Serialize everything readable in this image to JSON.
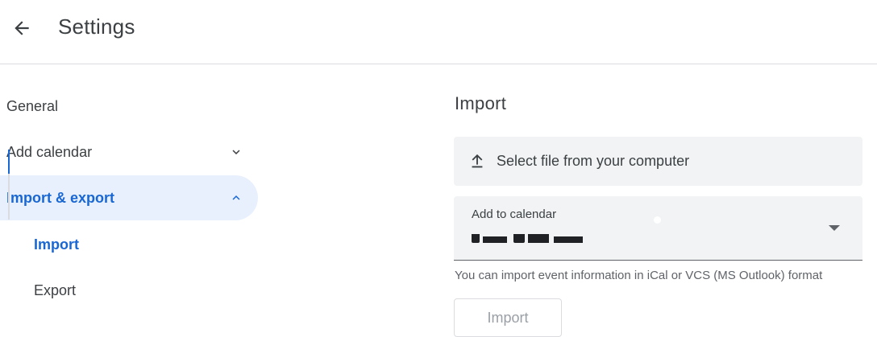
{
  "header": {
    "back_icon": "arrow-back-icon",
    "title": "Settings"
  },
  "sidebar": {
    "items": [
      {
        "label": "General"
      },
      {
        "label": "Add calendar",
        "icon": "chevron-down-icon",
        "expanded": false
      },
      {
        "label": "Import & export",
        "icon": "chevron-up-icon",
        "expanded": true,
        "active": true
      }
    ],
    "subitems": [
      {
        "label": "Import",
        "active": true
      },
      {
        "label": "Export",
        "active": false
      }
    ]
  },
  "main": {
    "section_title": "Import",
    "select_file": {
      "icon": "upload-icon",
      "label": "Select file from your computer"
    },
    "calendar_select": {
      "label": "Add to calendar",
      "value": "",
      "caret_icon": "dropdown-arrow-icon"
    },
    "help_text": "You can import event information in iCal or VCS (MS Outlook) format",
    "import_button": {
      "label": "Import",
      "disabled": true
    }
  },
  "colors": {
    "accent": "#1967d2",
    "active_bg": "#e8f0fe",
    "field_bg": "#f1f3f4",
    "divider": "#dadce0",
    "text": "#3c4043",
    "muted": "#5f6368",
    "disabled_text": "#9aa0a6"
  }
}
